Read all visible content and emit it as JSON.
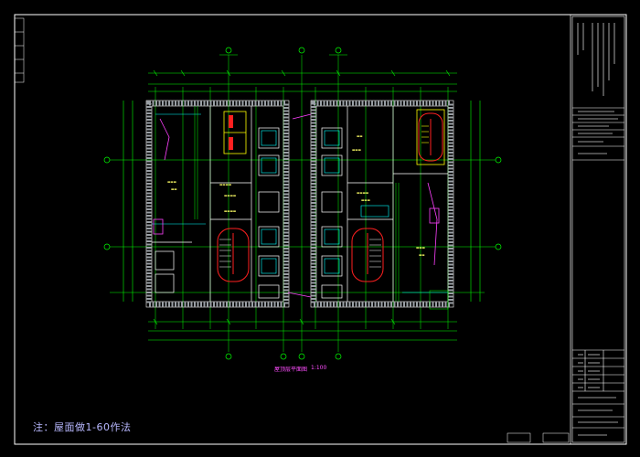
{
  "drawing": {
    "plan_title": "屋顶层平面图",
    "plan_scale": "1:100",
    "note": "注：屋面做1-60作法"
  },
  "colors": {
    "background": "#000000",
    "frame": "#ffffff",
    "wall": "#ffffff",
    "axis": "#00ff00",
    "dimension": "#00ff00",
    "hatch": "#9aa0a6",
    "cyan": "#00ffff",
    "red": "#ff2020",
    "yellow": "#ffff00",
    "magenta": "#ff40ff",
    "note": "#b8b8ff"
  }
}
